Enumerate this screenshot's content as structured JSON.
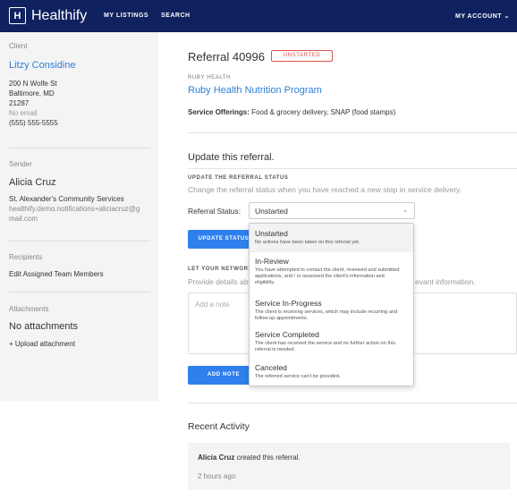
{
  "nav": {
    "logo_text": "Healthify",
    "logo_glyph": "H",
    "my_listings": "MY LISTINGS",
    "search": "SEARCH",
    "my_account": "MY ACCOUNT",
    "account_chevron": "⌄"
  },
  "sidebar": {
    "client_label": "Client",
    "client_name": "Litzy Considine",
    "address_line1": "200 N Wolfe St",
    "address_line2": "Baltimore, MD",
    "zip": "21287",
    "email": "No email",
    "phone": "(555) 555-5555",
    "sender_label": "Sender",
    "sender_name": "Alicia Cruz",
    "sender_org": "St. Alexander's Community Services",
    "sender_email_1": "healthify.demo.notifications+aliciacruz@g",
    "sender_email_2": "mail.com",
    "recipients_label": "Recipients",
    "edit_team": "Edit Assigned Team Members",
    "attachments_label": "Attachments",
    "no_attachments": "No attachments",
    "upload": "+ Upload attachment"
  },
  "referral": {
    "title": "Referral 40996",
    "status_badge": "UNSTARTED",
    "org_label": "RUBY HEALTH",
    "program": "Ruby Health Nutrition Program",
    "offerings_label": "Service Offerings:",
    "offerings_value": "Food & grocery delivery, SNAP (food stamps)"
  },
  "update": {
    "title": "Update this referral.",
    "status_heading": "UPDATE THE REFERRAL STATUS",
    "status_help": "Change the referral status when you have reached a new step in service delivery.",
    "status_label": "Referral Status:",
    "status_value": "Unstarted",
    "chevron": "⌄",
    "update_button": "UPDATE STATUS",
    "network_heading": "LET YOUR NETWORK",
    "network_help_left": "Provide details ab",
    "network_help_right": "evant information.",
    "note_placeholder": "Add a note",
    "add_note_button": "ADD NOTE"
  },
  "status_options": [
    {
      "title": "Unstarted",
      "desc": "No actions have been taken on this referral yet."
    },
    {
      "title": "In-Review",
      "desc": "You have attempted to contact the client, reviewed and submitted applications, and / or assessed the client's information and eligibility."
    },
    {
      "title": "Service In-Progress",
      "desc": "The client is receiving services, which may include recurring and follow-up appointments."
    },
    {
      "title": "Service Completed",
      "desc": "The client has received the service and no further action on this referral is needed."
    },
    {
      "title": "Canceled",
      "desc": "The referred service can't be provided."
    }
  ],
  "activity": {
    "title": "Recent Activity",
    "actor": "Alicia Cruz",
    "action": " created this referral.",
    "time": "2 hours ago"
  }
}
